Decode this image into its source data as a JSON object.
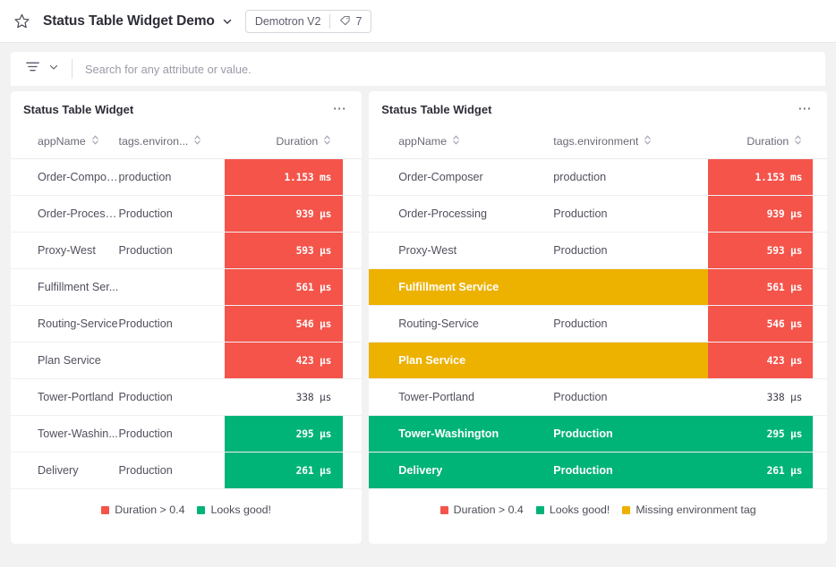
{
  "topbar": {
    "star_icon": "star-outline-icon",
    "title": "Status Table Widget Demo",
    "title_caret_icon": "chevron-down-icon",
    "env_chip": {
      "name": "Demotron V2",
      "tag_icon": "tag-icon",
      "tag_count": "7"
    }
  },
  "search": {
    "filter_icon": "filter-icon",
    "caret_icon": "chevron-down-icon",
    "placeholder": "Search for any attribute or value.",
    "value": ""
  },
  "colors": {
    "red": "#f4544a",
    "green": "#00b377",
    "yellow": "#edb100",
    "page_background": "#f2f2f2",
    "panel_background": "#ffffff"
  },
  "panels": [
    {
      "title": "Status Table Widget",
      "menu_icon": "more-horizontal-icon",
      "columns": [
        {
          "label": "appName",
          "sort_icon": "sort-icon"
        },
        {
          "label": "tags.environ...",
          "sort_icon": "sort-icon"
        },
        {
          "label": "Duration",
          "sort_icon": "sort-icon"
        }
      ],
      "rows": [
        {
          "app": "Order-Composer",
          "env": "production",
          "duration": "1.153 ms",
          "duration_state": "red",
          "row_state": "none"
        },
        {
          "app": "Order-Processi...",
          "env": "Production",
          "duration": "939 µs",
          "duration_state": "red",
          "row_state": "none"
        },
        {
          "app": "Proxy-West",
          "env": "Production",
          "duration": "593 µs",
          "duration_state": "red",
          "row_state": "none"
        },
        {
          "app": "Fulfillment Ser...",
          "env": "",
          "duration": "561 µs",
          "duration_state": "red",
          "row_state": "none"
        },
        {
          "app": "Routing-Service",
          "env": "Production",
          "duration": "546 µs",
          "duration_state": "red",
          "row_state": "none"
        },
        {
          "app": "Plan Service",
          "env": "",
          "duration": "423 µs",
          "duration_state": "red",
          "row_state": "none"
        },
        {
          "app": "Tower-Portland",
          "env": "Production",
          "duration": "338 µs",
          "duration_state": "none",
          "row_state": "none"
        },
        {
          "app": "Tower-Washin...",
          "env": "Production",
          "duration": "295 µs",
          "duration_state": "green",
          "row_state": "none"
        },
        {
          "app": "Delivery",
          "env": "Production",
          "duration": "261 µs",
          "duration_state": "green",
          "row_state": "none"
        }
      ],
      "legend": [
        {
          "label": "Duration > 0.4",
          "color": "#f4544a"
        },
        {
          "label": "Looks good!",
          "color": "#00b377"
        }
      ]
    },
    {
      "title": "Status Table Widget",
      "menu_icon": "more-horizontal-icon",
      "columns": [
        {
          "label": "appName",
          "sort_icon": "sort-icon"
        },
        {
          "label": "tags.environment",
          "sort_icon": "sort-icon"
        },
        {
          "label": "Duration",
          "sort_icon": "sort-icon"
        }
      ],
      "rows": [
        {
          "app": "Order-Composer",
          "env": "production",
          "duration": "1.153 ms",
          "duration_state": "red",
          "row_state": "none"
        },
        {
          "app": "Order-Processing",
          "env": "Production",
          "duration": "939 µs",
          "duration_state": "red",
          "row_state": "none"
        },
        {
          "app": "Proxy-West",
          "env": "Production",
          "duration": "593 µs",
          "duration_state": "red",
          "row_state": "none"
        },
        {
          "app": "Fulfillment Service",
          "env": "",
          "duration": "561 µs",
          "duration_state": "red",
          "row_state": "yellow"
        },
        {
          "app": "Routing-Service",
          "env": "Production",
          "duration": "546 µs",
          "duration_state": "red",
          "row_state": "none"
        },
        {
          "app": "Plan Service",
          "env": "",
          "duration": "423 µs",
          "duration_state": "red",
          "row_state": "yellow"
        },
        {
          "app": "Tower-Portland",
          "env": "Production",
          "duration": "338 µs",
          "duration_state": "none",
          "row_state": "none"
        },
        {
          "app": "Tower-Washington",
          "env": "Production",
          "duration": "295 µs",
          "duration_state": "green",
          "row_state": "green"
        },
        {
          "app": "Delivery",
          "env": "Production",
          "duration": "261 µs",
          "duration_state": "green",
          "row_state": "green"
        }
      ],
      "legend": [
        {
          "label": "Duration > 0.4",
          "color": "#f4544a"
        },
        {
          "label": "Looks good!",
          "color": "#00b377"
        },
        {
          "label": "Missing environment tag",
          "color": "#edb100"
        }
      ]
    }
  ]
}
